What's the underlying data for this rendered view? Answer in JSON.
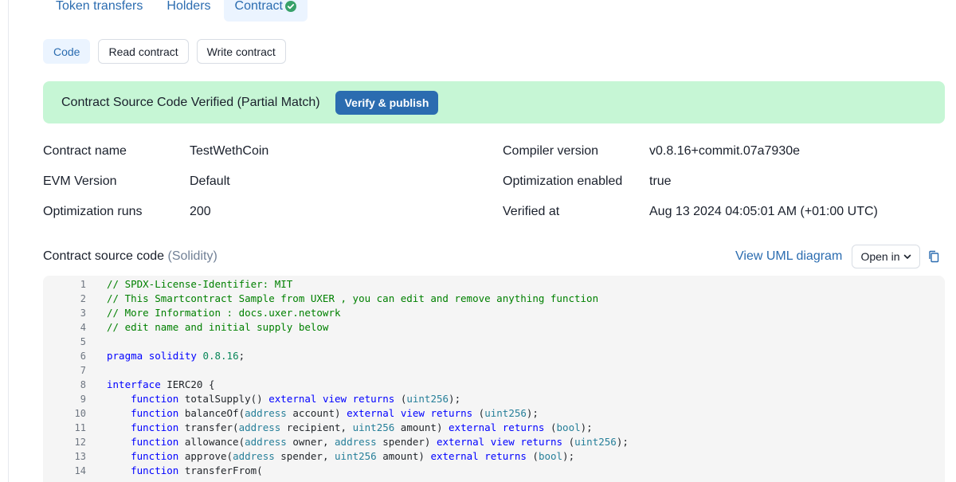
{
  "tabs": [
    {
      "label": "Token transfers"
    },
    {
      "label": "Holders"
    },
    {
      "label": "Contract"
    }
  ],
  "subtabs": [
    {
      "label": "Code"
    },
    {
      "label": "Read contract"
    },
    {
      "label": "Write contract"
    }
  ],
  "banner": {
    "text": "Contract Source Code Verified (Partial Match)",
    "button": "Verify & publish"
  },
  "info": {
    "contract_name_label": "Contract name",
    "contract_name": "TestWethCoin",
    "evm_label": "EVM Version",
    "evm": "Default",
    "opt_runs_label": "Optimization runs",
    "opt_runs": "200",
    "compiler_label": "Compiler version",
    "compiler": "v0.8.16+commit.07a7930e",
    "opt_enabled_label": "Optimization enabled",
    "opt_enabled": "true",
    "verified_label": "Verified at",
    "verified": "Aug 13 2024 04:05:01 AM (+01:00 UTC)"
  },
  "source": {
    "title": "Contract source code",
    "lang": "(Solidity)",
    "uml": "View UML diagram",
    "open_in": "Open in"
  },
  "code_lines": [
    {
      "n": "1",
      "text": "// SPDX-License-Identifier: MIT"
    },
    {
      "n": "2",
      "text": "// This Smartcontract Sample from UXER , you can edit and remove anything function"
    },
    {
      "n": "3",
      "text": "// More Information : docs.uxer.netowrk"
    },
    {
      "n": "4",
      "text": "// edit name and initial supply below"
    },
    {
      "n": "5",
      "text": ""
    },
    {
      "n": "6",
      "text": "pragma solidity 0.8.16;"
    },
    {
      "n": "7",
      "text": ""
    },
    {
      "n": "8",
      "text": "interface IERC20 {"
    },
    {
      "n": "9",
      "text": "    function totalSupply() external view returns (uint256);"
    },
    {
      "n": "10",
      "text": "    function balanceOf(address account) external view returns (uint256);"
    },
    {
      "n": "11",
      "text": "    function transfer(address recipient, uint256 amount) external returns (bool);"
    },
    {
      "n": "12",
      "text": "    function allowance(address owner, address spender) external view returns (uint256);"
    },
    {
      "n": "13",
      "text": "    function approve(address spender, uint256 amount) external returns (bool);"
    },
    {
      "n": "14",
      "text": "    function transferFrom("
    }
  ],
  "colors": {
    "accent": "#2b6cb0",
    "banner_bg": "#c6f6d5",
    "comment": "#008000",
    "keyword": "#0000ff",
    "type": "#267f99"
  },
  "icons": {
    "verified": "check-circle-icon",
    "dropdown": "chevron-down-icon",
    "copy": "copy-icon"
  }
}
